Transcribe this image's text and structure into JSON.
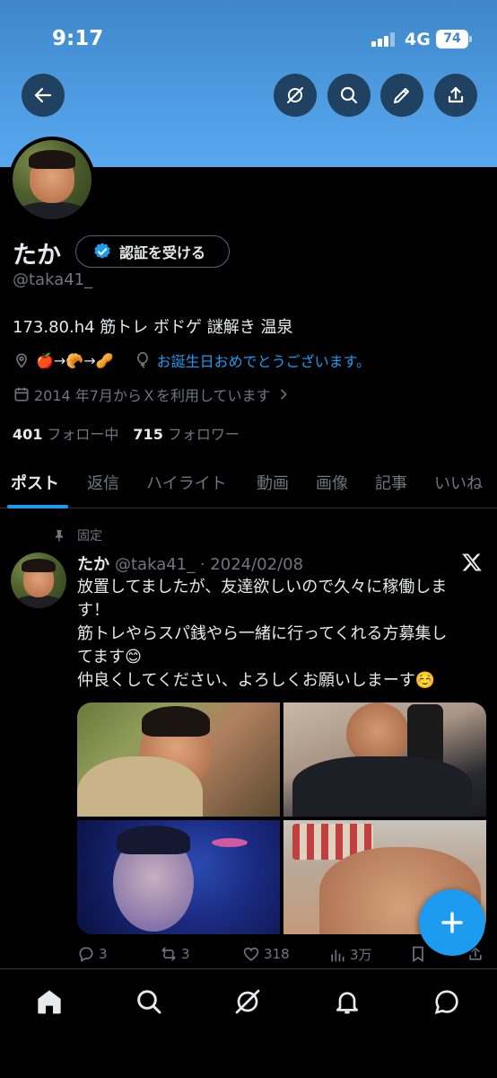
{
  "status": {
    "time": "9:17",
    "network": "4G",
    "battery": "74"
  },
  "profile": {
    "name": "たか",
    "verify_label": "認証を受ける",
    "handle": "@taka41_",
    "bio": "173.80.h4 筋トレ ボドゲ 謎解き 温泉",
    "location": "🍎→🥐→🥜",
    "birthday": "お誕生日おめでとうございます。",
    "joined": "2014 年7月からＸを利用しています",
    "following_count": "401",
    "following_label": "フォロー中",
    "followers_count": "715",
    "followers_label": "フォロワー"
  },
  "tabs": [
    "ポスト",
    "返信",
    "ハイライト",
    "動画",
    "画像",
    "記事",
    "いいね"
  ],
  "post": {
    "pinned_label": "固定",
    "author": "たか",
    "handle_date": "@taka41_ · 2024/02/08",
    "text_lines": [
      "放置してましたが、友達欲しいので久々に稼働しま",
      "す！",
      "筋トレやらスパ銭やら一緒に行ってくれる方募集し",
      "てます😊",
      "仲良くしてください、よろしくお願いしまーす☺️"
    ],
    "replies": "3",
    "reposts": "3",
    "likes": "318",
    "views": "3万"
  },
  "colors": {
    "accent": "#1d9bf0",
    "banner": "#4a97dc",
    "background": "#000000"
  }
}
